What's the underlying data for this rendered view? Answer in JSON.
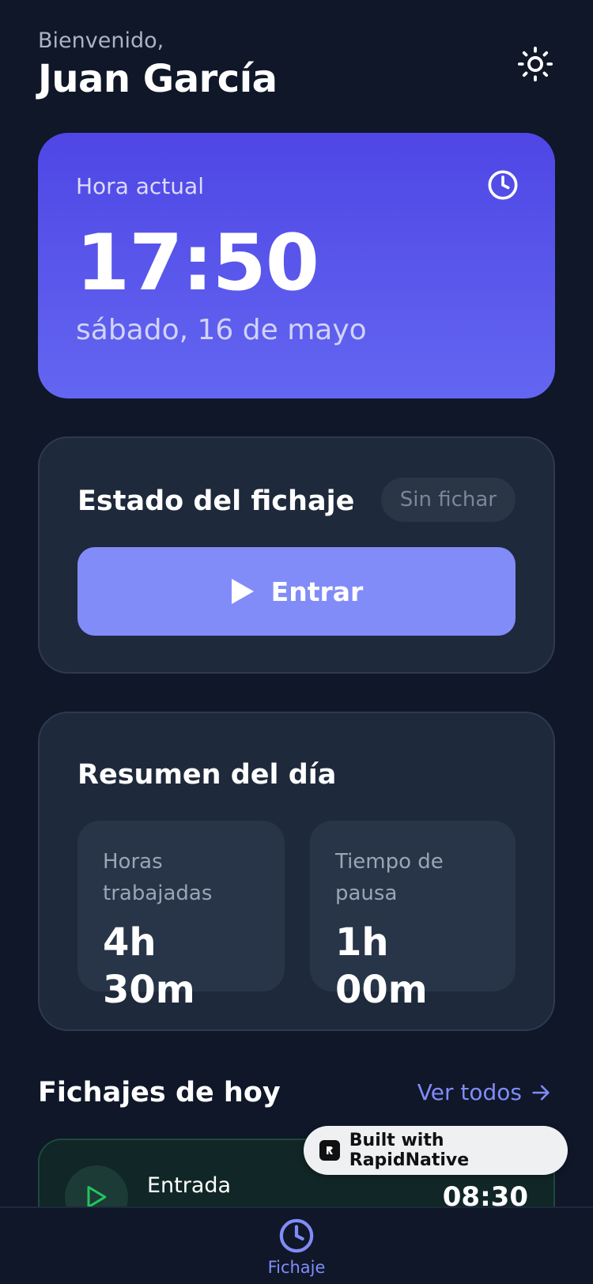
{
  "header": {
    "greeting": "Bienvenido,",
    "user_name": "Juan García",
    "theme_icon": "sun-icon"
  },
  "time_card": {
    "label": "Hora actual",
    "time": "17:50",
    "date": "sábado, 16 de mayo",
    "icon": "clock-icon",
    "gradient": [
      "#4f46e5",
      "#6366f1"
    ]
  },
  "status_card": {
    "title": "Estado del fichaje",
    "badge": "Sin fichar",
    "button_label": "Entrar",
    "button_icon": "play-icon",
    "button_color": "#818cf8"
  },
  "summary_card": {
    "title": "Resumen del día",
    "stats": [
      {
        "label": "Horas trabajadas",
        "value": "4h 30m"
      },
      {
        "label": "Tiempo de pausa",
        "value": "1h 00m"
      }
    ]
  },
  "today": {
    "title": "Fichajes de hoy",
    "see_all": "Ver todos",
    "entries": [
      {
        "type": "Entrada",
        "time": "08:30",
        "icon": "play-icon",
        "color": "#22c55e"
      }
    ]
  },
  "built_badge": {
    "label": "Built with RapidNative"
  },
  "bottom_nav": {
    "items": [
      {
        "label": "Fichaje",
        "icon": "clock-icon",
        "active": true
      }
    ]
  }
}
